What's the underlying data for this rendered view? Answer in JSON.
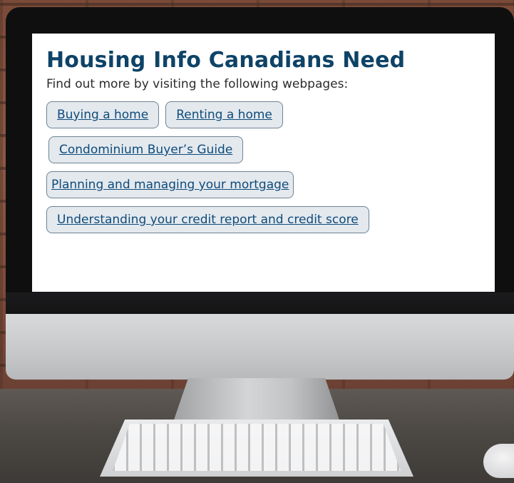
{
  "panel": {
    "title": "Housing Info Canadians Need",
    "subtitle": "Find out more by visiting the following webpages:"
  },
  "links": [
    {
      "label": "Buying a home"
    },
    {
      "label": "Renting a home"
    },
    {
      "label": "Condominium Buyer’s Guide"
    },
    {
      "label": "Planning and managing your mortgage"
    },
    {
      "label": "Understanding your credit report and credit score"
    }
  ],
  "colors": {
    "title": "#0e4367",
    "link_text": "#0e4b7a",
    "link_background": "#e4e9ee",
    "link_border": "#6d8394"
  }
}
